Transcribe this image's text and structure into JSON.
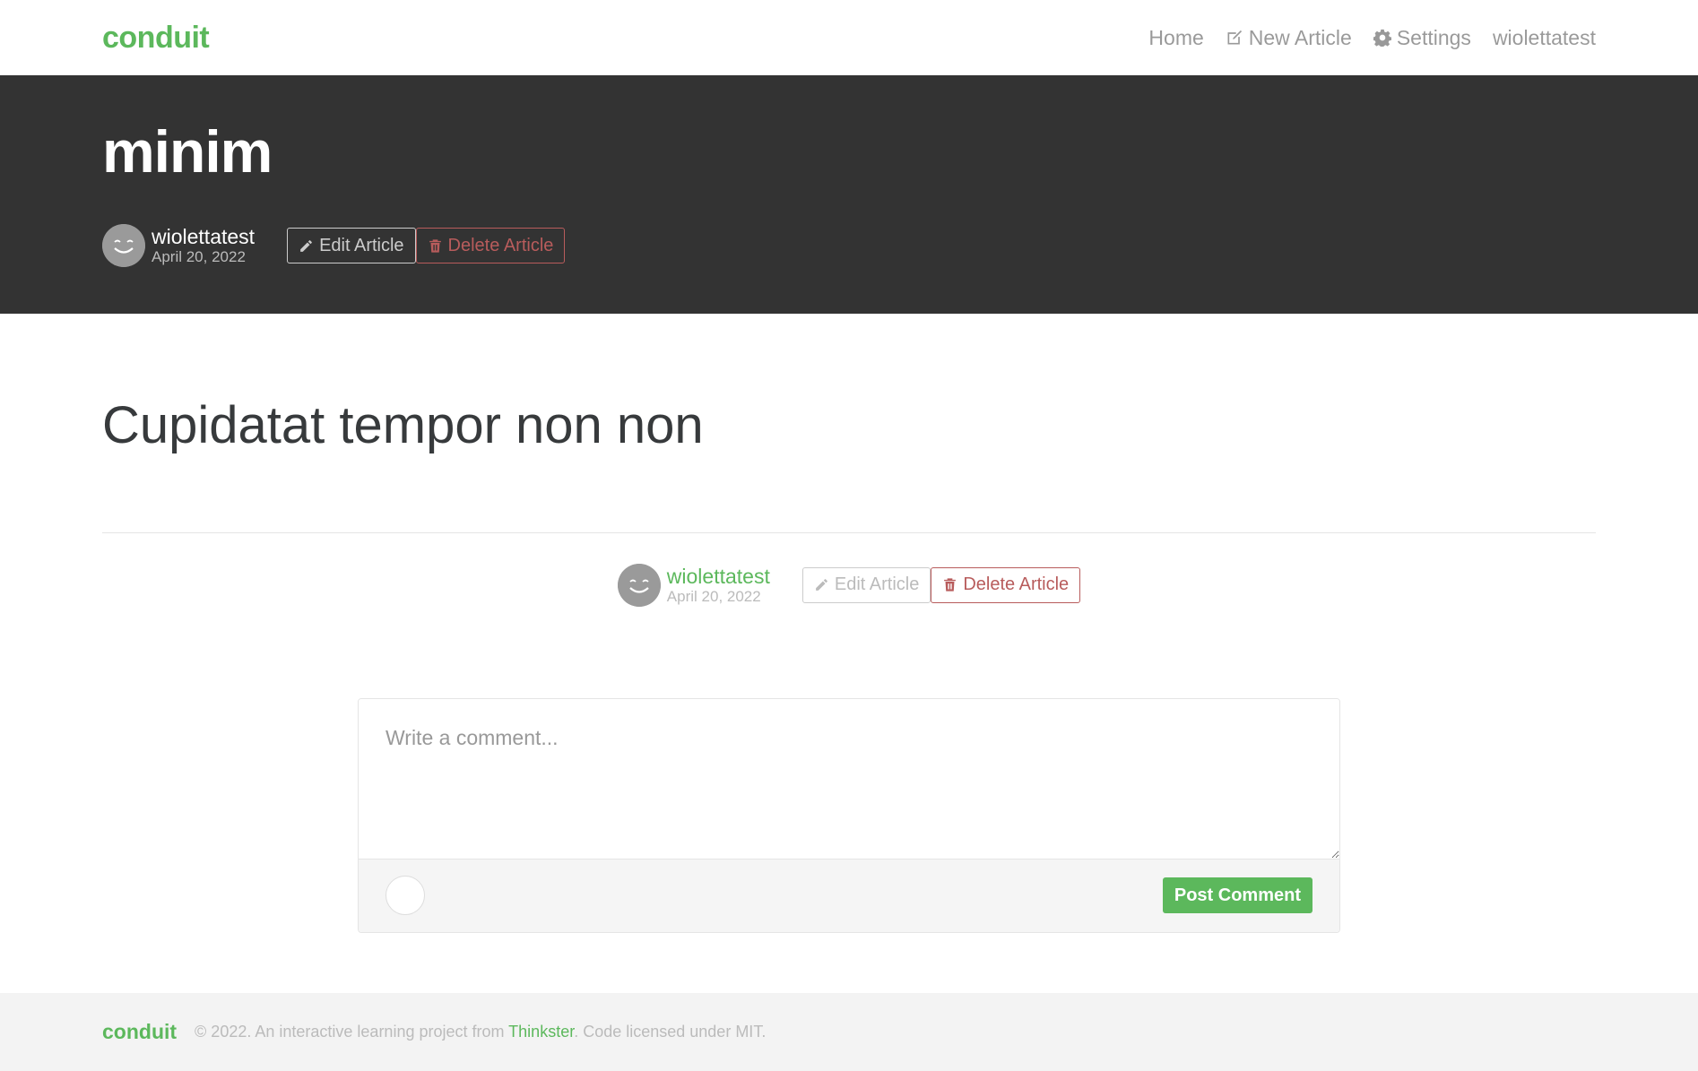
{
  "navbar": {
    "brand": "conduit",
    "links": [
      {
        "label": "Home",
        "icon": "none"
      },
      {
        "label": "New Article",
        "icon": "compose-icon"
      },
      {
        "label": "Settings",
        "icon": "gear-icon"
      },
      {
        "label": "wiolettatest",
        "icon": "none"
      }
    ]
  },
  "article": {
    "title": "minim",
    "author": "wiolettatest",
    "date": "April 20, 2022",
    "body": "Cupidatat tempor non non",
    "edit_label": "Edit Article",
    "delete_label": "Delete Article"
  },
  "comment_form": {
    "placeholder": "Write a comment...",
    "post_label": "Post Comment"
  },
  "footer": {
    "brand": "conduit",
    "prefix": "© 2022. An interactive learning project from ",
    "link": "Thinkster",
    "suffix": ". Code licensed under MIT."
  },
  "colors": {
    "brand": "#5cb85c",
    "banner": "#333333",
    "danger": "#b85c5c"
  }
}
